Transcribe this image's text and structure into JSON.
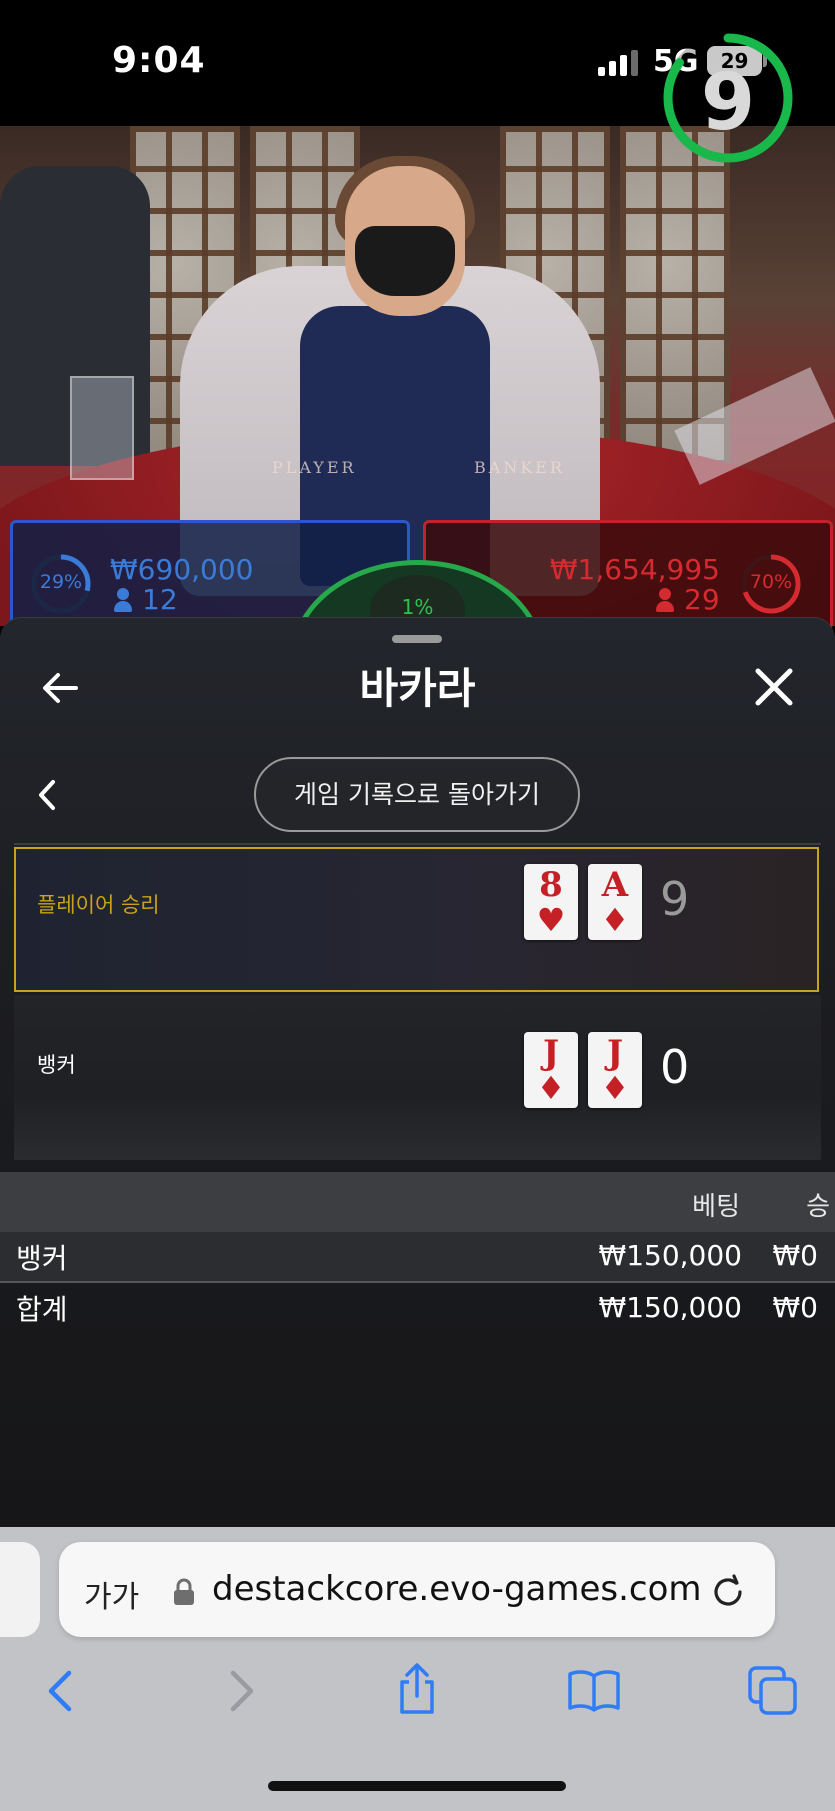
{
  "status_bar": {
    "time": "9:04",
    "network": "5G",
    "battery": "29"
  },
  "live_video": {
    "table_player_text": "PLAYER",
    "table_banker_text": "BANKER",
    "timer_value": "9",
    "timer_progress": 0.85
  },
  "bet_stats": {
    "player": {
      "percent": "29%",
      "amount": "₩690,000",
      "players": "12",
      "color": "#3b7bd8"
    },
    "tie": {
      "percent": "1%",
      "color": "#2fc24f"
    },
    "banker": {
      "percent": "70%",
      "amount": "₩1,654,995",
      "players": "29",
      "color": "#d52a2f"
    }
  },
  "panel": {
    "title": "바카라",
    "history_button": "게임 기록으로 돌아가기",
    "rounds": [
      {
        "label": "플레이어 승리",
        "cards": [
          {
            "rank": "8",
            "suit": "♥"
          },
          {
            "rank": "A",
            "suit": "♦"
          }
        ],
        "score": "9",
        "winner": true
      },
      {
        "label": "뱅커",
        "cards": [
          {
            "rank": "J",
            "suit": "♦"
          },
          {
            "rank": "J",
            "suit": "♦"
          }
        ],
        "score": "0",
        "winner": false
      }
    ],
    "bets_table": {
      "headers": {
        "bet": "베팅",
        "win": "승"
      },
      "rows": [
        {
          "label": "뱅커",
          "bet": "₩150,000",
          "win": "₩0"
        }
      ],
      "total": {
        "label": "합계",
        "bet": "₩150,000",
        "win": "₩0"
      }
    }
  },
  "browser": {
    "aa_label": "가가",
    "url": "destackcore.evo-games.com"
  },
  "colors": {
    "accent_gold": "#c9a21a",
    "card_red": "#c62027",
    "ios_blue": "#2f7cf6"
  }
}
